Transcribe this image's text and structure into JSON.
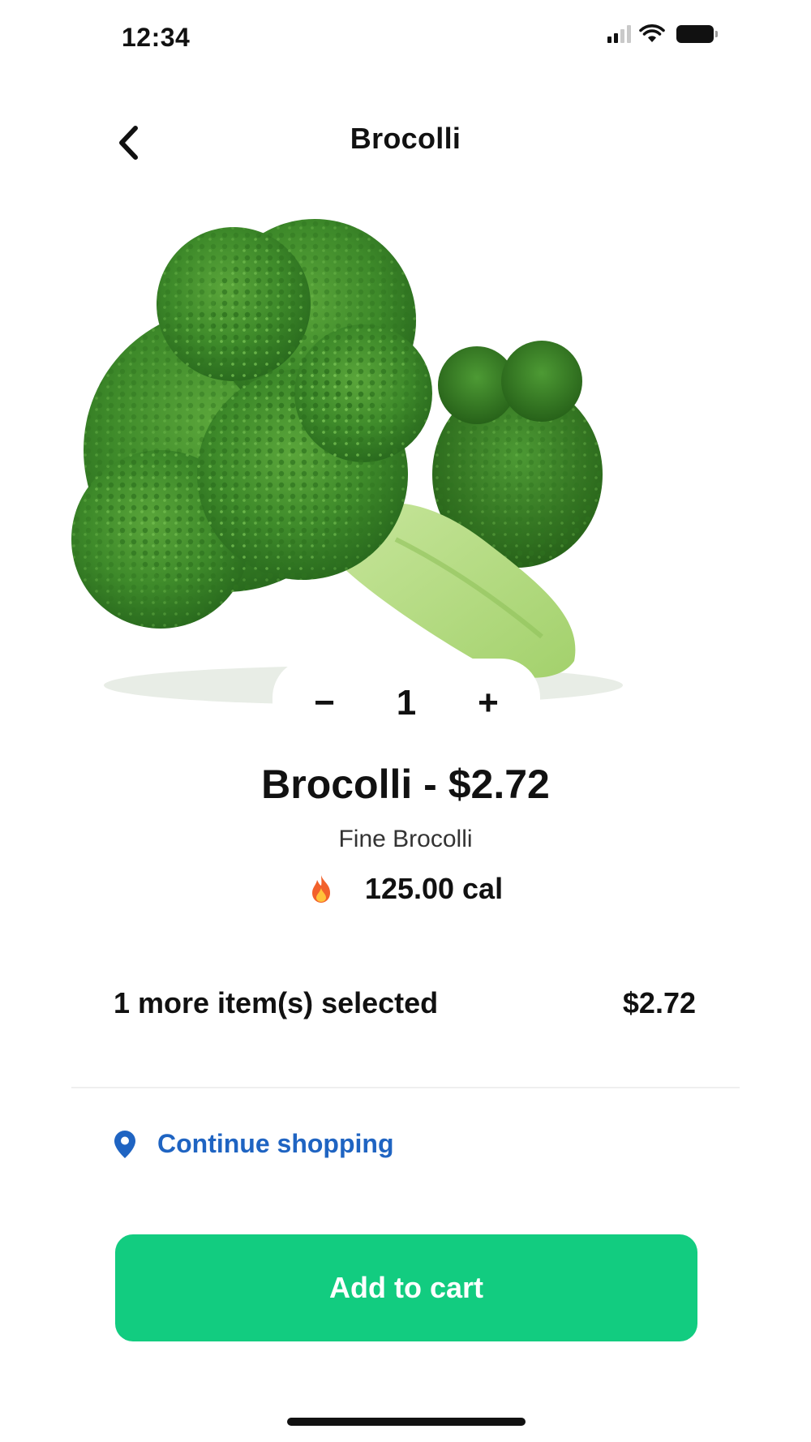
{
  "status_bar": {
    "time": "12:34"
  },
  "header": {
    "title": "Brocolli"
  },
  "product": {
    "image_icon": "broccoli-photo",
    "quantity": "1",
    "decrement_label": "−",
    "increment_label": "+",
    "name_price": "Brocolli - $2.72",
    "description": "Fine Brocolli",
    "calories": "125.00 cal"
  },
  "summary": {
    "label": "1 more item(s) selected",
    "price": "$2.72"
  },
  "continue": {
    "label": "Continue shopping",
    "color": "#1f64c2"
  },
  "cart_button": {
    "label": "Add to cart",
    "color": "#12cc80"
  }
}
